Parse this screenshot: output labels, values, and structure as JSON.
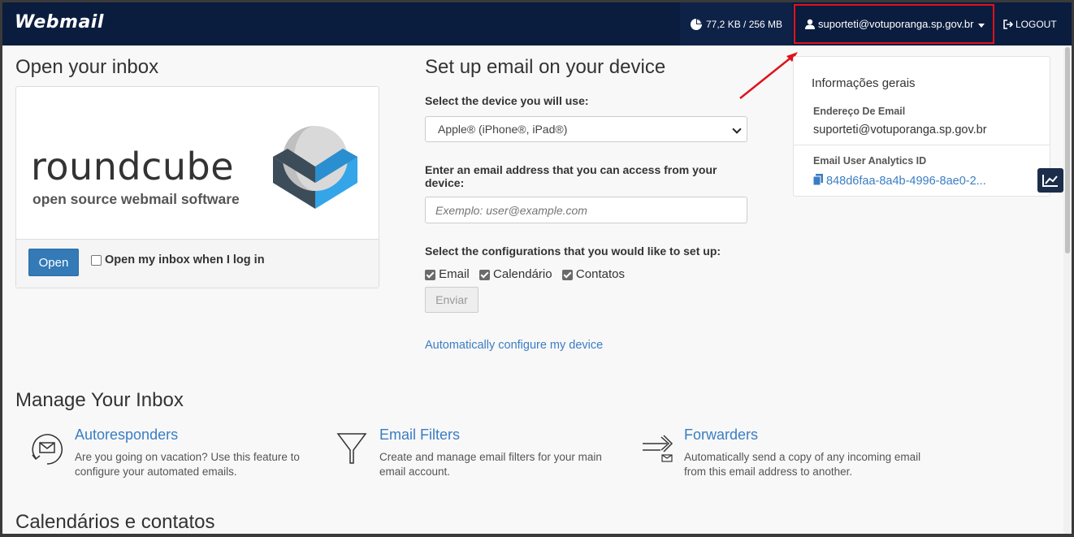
{
  "header": {
    "logo": "Webmail",
    "quota": "77,2 KB / 256 MB",
    "user": "suporteti@votuporanga.sp.gov.br",
    "logout": "LOGOUT"
  },
  "inbox": {
    "title": "Open your inbox",
    "roundcube_word": "roundcube",
    "roundcube_tagline": "open source webmail software",
    "open_button": "Open",
    "open_on_login_label": "Open my inbox when I log in"
  },
  "setup": {
    "title": "Set up email on your device",
    "device_label": "Select the device you will use:",
    "device_selected": "Apple® (iPhone®, iPad®)",
    "email_label": "Enter an email address that you can access from your device:",
    "email_placeholder": "Exemplo: user@example.com",
    "config_label": "Select the configurations that you would like to set up:",
    "options": [
      "Email",
      "Calendário",
      "Contatos"
    ],
    "send_button": "Enviar",
    "auto_link": "Automatically configure my device"
  },
  "info": {
    "title": "Informações gerais",
    "email_key": "Endereço De Email",
    "email_value": "suporteti@votuporanga.sp.gov.br",
    "analytics_key": "Email User Analytics ID",
    "analytics_value": "848d6faa-8a4b-4996-8ae0-2..."
  },
  "manage": {
    "title": "Manage Your Inbox",
    "features": [
      {
        "title": "Autoresponders",
        "desc": "Are you going on vacation? Use this feature to configure your automated emails.",
        "icon": "autoresponder-icon"
      },
      {
        "title": "Email Filters",
        "desc": "Create and manage email filters for your main email account.",
        "icon": "filter-icon"
      },
      {
        "title": "Forwarders",
        "desc": "Automatically send a copy of any incoming email from this email address to another.",
        "icon": "forwarder-icon"
      }
    ]
  },
  "calendars": {
    "title": "Calendários e contatos"
  }
}
